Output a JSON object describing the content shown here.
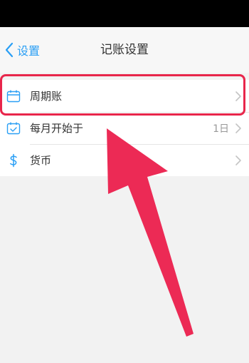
{
  "nav": {
    "back_label": "设置",
    "title": "记账设置"
  },
  "settings": [
    {
      "label": "周期账",
      "value": "",
      "icon": "calendar-icon"
    },
    {
      "label": "每月开始于",
      "value": "1日",
      "icon": "calendar-check-icon"
    },
    {
      "label": "货币",
      "value": "",
      "icon": "dollar-icon"
    }
  ],
  "colors": {
    "accent": "#2a9ff5",
    "annotation": "#e8264b"
  }
}
